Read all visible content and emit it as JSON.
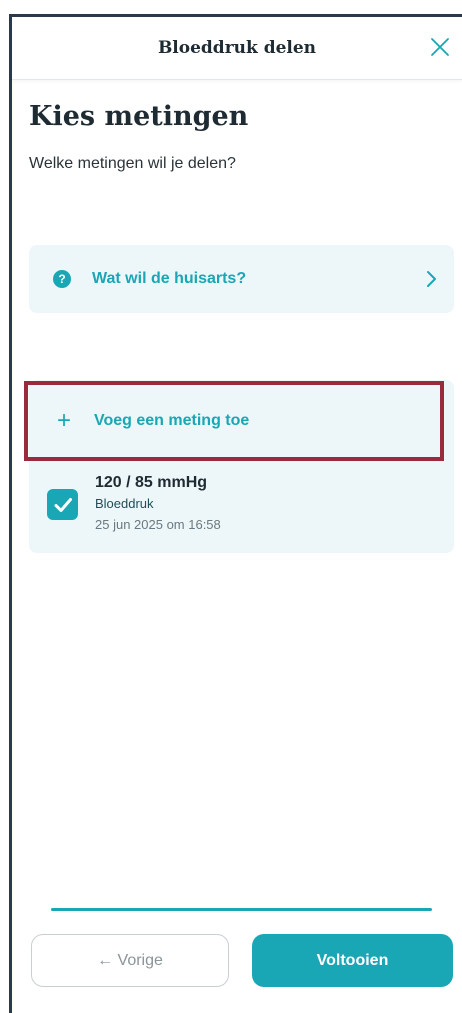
{
  "header": {
    "title": "Bloeddruk delen",
    "close_icon": "close-icon"
  },
  "page": {
    "title": "Kies metingen",
    "subtitle": "Welke metingen wil je delen?"
  },
  "info_card": {
    "icon": "question-icon",
    "icon_glyph": "?",
    "label": "Wat wil de huisarts?"
  },
  "add_measurement": {
    "icon_glyph": "+",
    "label": "Voeg een meting toe"
  },
  "measurements": [
    {
      "checked": true,
      "value": "120 / 85 mmHg",
      "type": "Bloeddruk",
      "date": "25 jun 2025 om 16:58"
    }
  ],
  "footer": {
    "prev_label": "← Vorige",
    "done_label": "Voltooien"
  },
  "colors": {
    "accent": "#1aa7b5",
    "card_bg": "#edf6f8",
    "highlight_border": "#9a2b3e",
    "text_dark": "#1f2b33"
  }
}
